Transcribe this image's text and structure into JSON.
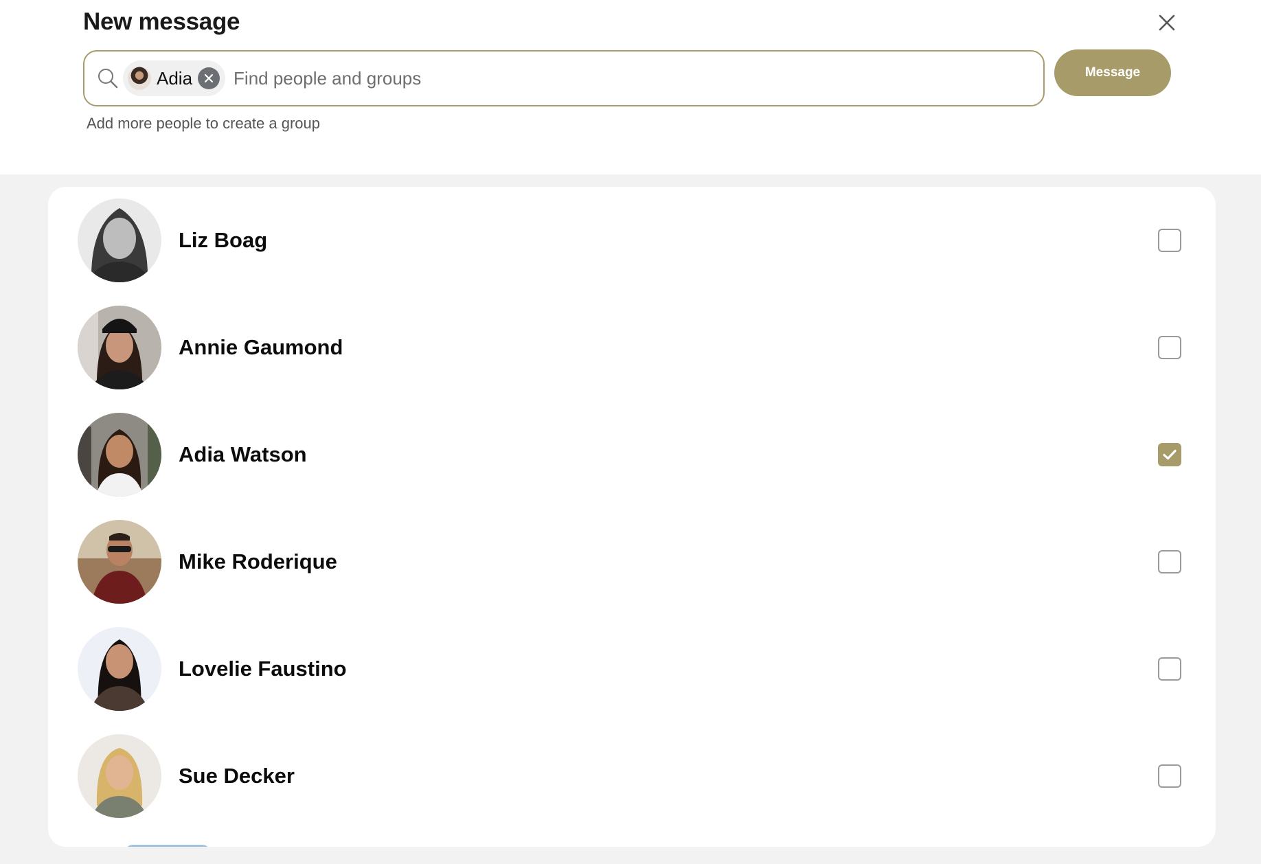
{
  "header": {
    "title": "New message",
    "helper_text": "Add more people to create a group",
    "message_label": "Message"
  },
  "search": {
    "placeholder": "Find people and groups",
    "chip_name": "Adia"
  },
  "accent_color": "#a89b6a",
  "contacts": [
    {
      "name": "Liz Boag",
      "checked": false
    },
    {
      "name": "Annie Gaumond",
      "checked": false
    },
    {
      "name": "Adia Watson",
      "checked": true
    },
    {
      "name": "Mike Roderique",
      "checked": false
    },
    {
      "name": "Lovelie Faustino",
      "checked": false
    },
    {
      "name": "Sue Decker",
      "checked": false
    }
  ],
  "icons": [
    "search-icon",
    "close-icon",
    "chip-remove-icon",
    "checkmark-icon"
  ]
}
